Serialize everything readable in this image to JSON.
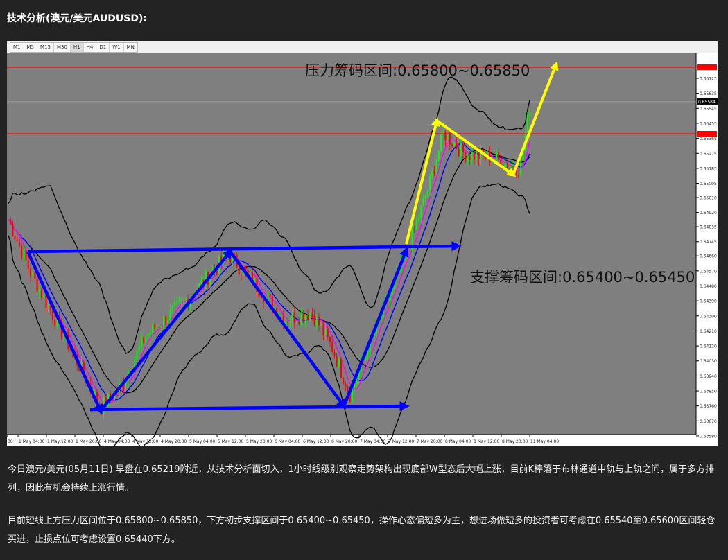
{
  "title": "技术分析(澳元/美元AUDUSD):",
  "timeframes": [
    "M1",
    "M5",
    "M15",
    "M30",
    "H1",
    "H4",
    "D1",
    "W1",
    "MN"
  ],
  "active_timeframe": "H1",
  "annotations": {
    "resistance": "压力筹码区间:0.65800~0.65850",
    "support": "支撑筹码区间:0.65400~0.65450"
  },
  "price_axis": {
    "ticks": [
      "0.65725",
      "0.65635",
      "0.65545",
      "0.65455",
      "0.65365",
      "0.65275",
      "0.65185",
      "0.65095",
      "0.65010",
      "0.64920",
      "0.64835",
      "0.64745",
      "0.64660",
      "0.64570",
      "0.64480",
      "0.64390",
      "0.64300",
      "0.64210",
      "0.64120",
      "0.64030",
      "0.63940",
      "0.63850",
      "0.63760",
      "0.63670",
      "0.63580"
    ],
    "current_price": "0.65584"
  },
  "time_axis": [
    "00",
    "1 May 04:00",
    "1 May 12:00",
    "1 May 20:00",
    "4 May 04:00",
    "4 May 12:00",
    "4 May 20:00",
    "5 May 04:00",
    "5 May 12:00",
    "5 May 20:00",
    "6 May 04:00",
    "6 May 12:00",
    "6 May 20:00",
    "7 May 04:00",
    "7 May 12:00",
    "7 May 20:00",
    "8 May 04:00",
    "8 May 12:00",
    "8 May 20:00",
    "11 May 04:00"
  ],
  "colors": {
    "background": "#7f7f7f",
    "bull_candle": "#00ff00",
    "bear_candle": "#ff0000",
    "bollinger": "#000000",
    "ma_blue": "#0000ff",
    "ma_magenta": "#ff00ff",
    "horizontal_line": "#ff0000",
    "arrow_blue": "#0000ff",
    "arrow_yellow": "#ffff00"
  },
  "paragraphs": [
    "今日澳元/美元(05月11日) 早盘在0.65219附近，从技术分析面切入，1小时线级别观察走势架构出现底部W型态后大幅上涨，目前K棒落于布林通道中轨与上轨之间，属于多方排列，因此有机会持续上涨行情。",
    "目前短线上方压力区间位于0.65800~0.65850，下方初步支撑区间于0.65400~0.65450，操作心态偏短多为主，想进场做短多的投资者可考虑在0.65540至0.65600区间轻仓买进，止损点位可考虑设置0.65440下方。"
  ]
}
